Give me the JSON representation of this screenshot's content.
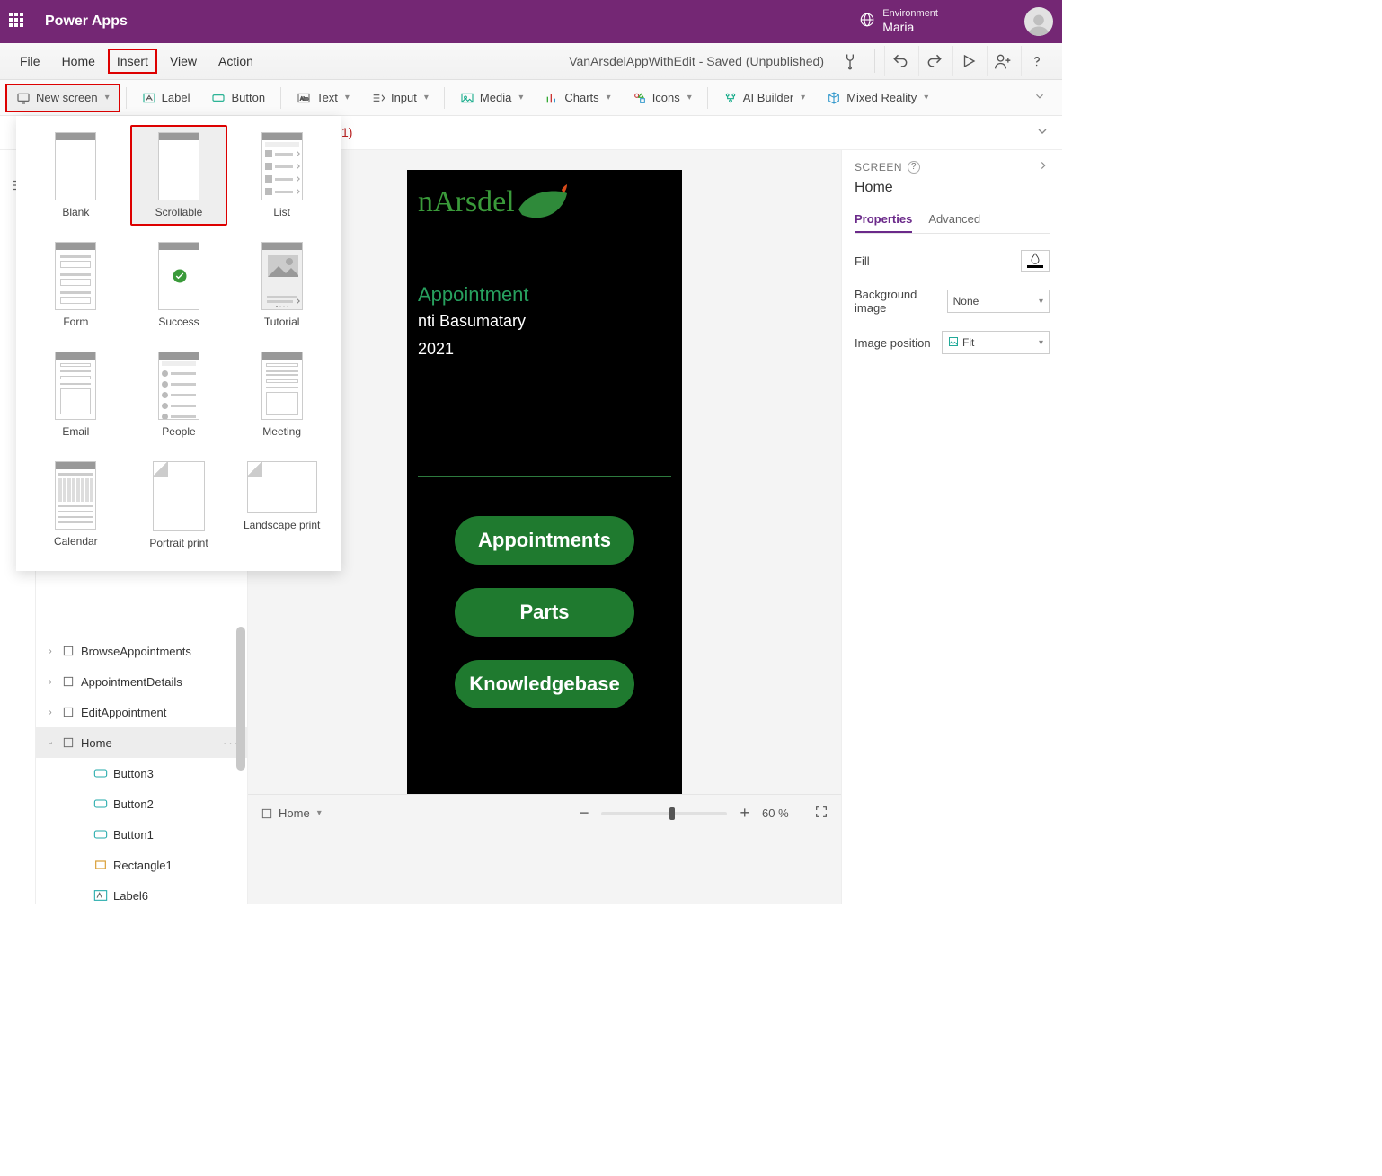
{
  "topbar": {
    "app_title": "Power Apps",
    "env_label": "Environment",
    "env_name": "Maria"
  },
  "menubar": {
    "items": [
      "File",
      "Home",
      "Insert",
      "View",
      "Action"
    ],
    "active_index": 2,
    "doc_title": "VanArsdelAppWithEdit - Saved (Unpublished)"
  },
  "ribbon": {
    "new_screen": "New screen",
    "label": "Label",
    "button": "Button",
    "text": "Text",
    "input": "Input",
    "media": "Media",
    "charts": "Charts",
    "icons": "Icons",
    "ai_builder": "AI Builder",
    "mixed_reality": "Mixed Reality"
  },
  "formula": {
    "visible_fragment": "1)"
  },
  "gallery": {
    "items": [
      {
        "label": "Blank"
      },
      {
        "label": "Scrollable",
        "highlight": true,
        "hover": true
      },
      {
        "label": "List"
      },
      {
        "label": "Form"
      },
      {
        "label": "Success"
      },
      {
        "label": "Tutorial"
      },
      {
        "label": "Email"
      },
      {
        "label": "People"
      },
      {
        "label": "Meeting"
      },
      {
        "label": "Calendar"
      },
      {
        "label": "Portrait print"
      },
      {
        "label": "Landscape print"
      }
    ]
  },
  "tree": {
    "items": [
      {
        "label": "BrowseAppointments",
        "expandable": true
      },
      {
        "label": "AppointmentDetails",
        "expandable": true
      },
      {
        "label": "EditAppointment",
        "expandable": true
      },
      {
        "label": "Home",
        "expandable": true,
        "expanded": true,
        "selected": true
      },
      {
        "label": "Button3",
        "child": true,
        "icon": "button"
      },
      {
        "label": "Button2",
        "child": true,
        "icon": "button"
      },
      {
        "label": "Button1",
        "child": true,
        "icon": "button"
      },
      {
        "label": "Rectangle1",
        "child": true,
        "icon": "rect"
      },
      {
        "label": "Label6",
        "child": true,
        "icon": "label"
      }
    ]
  },
  "phone": {
    "logo_text": "nArsdel",
    "appt_title": "Appointment",
    "appt_sub": "nti Basumatary",
    "appt_date": "2021",
    "btn1": "Appointments",
    "btn2": "Parts",
    "btn3": "Knowledgebase"
  },
  "bottombar": {
    "screen_name": "Home",
    "zoom": "60",
    "zoom_unit": "%"
  },
  "props": {
    "header": "SCREEN",
    "screen_name": "Home",
    "tab_properties": "Properties",
    "tab_advanced": "Advanced",
    "fill_label": "Fill",
    "bg_label": "Background image",
    "bg_value": "None",
    "imgpos_label": "Image position",
    "imgpos_value": "Fit"
  }
}
